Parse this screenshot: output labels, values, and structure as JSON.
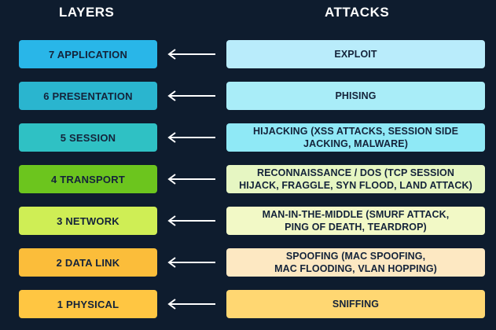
{
  "headers": {
    "layers": "LAYERS",
    "attacks": "ATTACKS"
  },
  "rows": [
    {
      "layer": "7 APPLICATION",
      "attack_lines": [
        "EXPLOIT"
      ],
      "layer_color": "#29b6e8",
      "attack_color": "#b9ecfb"
    },
    {
      "layer": "6 PRESENTATION",
      "attack_lines": [
        "PHISING"
      ],
      "layer_color": "#2ab5cf",
      "attack_color": "#a9edf8"
    },
    {
      "layer": "5 SESSION",
      "attack_lines": [
        "HIJACKING (XSS ATTACKS, SESSION SIDE",
        "JACKING, MALWARE)"
      ],
      "layer_color": "#2fc1c4",
      "attack_color": "#8fe9f6"
    },
    {
      "layer": "4 TRANSPORT",
      "attack_lines": [
        "RECONNAISSANCE / DOS (TCP SESSION",
        "HIJACK, FRAGGLE, SYN FLOOD, LAND ATTACK)"
      ],
      "layer_color": "#6cc51e",
      "attack_color": "#e6f6c2"
    },
    {
      "layer": "3 NETWORK",
      "attack_lines": [
        "MAN-IN-THE-MIDDLE (SMURF ATTACK,",
        "PING OF DEATH, TEARDROP)"
      ],
      "layer_color": "#cfee55",
      "attack_color": "#f2f9c6"
    },
    {
      "layer": "2 DATA LINK",
      "attack_lines": [
        "SPOOFING (MAC SPOOFING,",
        "MAC FLOODING, VLAN HOPPING)"
      ],
      "layer_color": "#fbbd3a",
      "attack_color": "#fde8c2"
    },
    {
      "layer": "1 PHYSICAL",
      "attack_lines": [
        "SNIFFING"
      ],
      "layer_color": "#ffc642",
      "attack_color": "#ffd772"
    }
  ]
}
